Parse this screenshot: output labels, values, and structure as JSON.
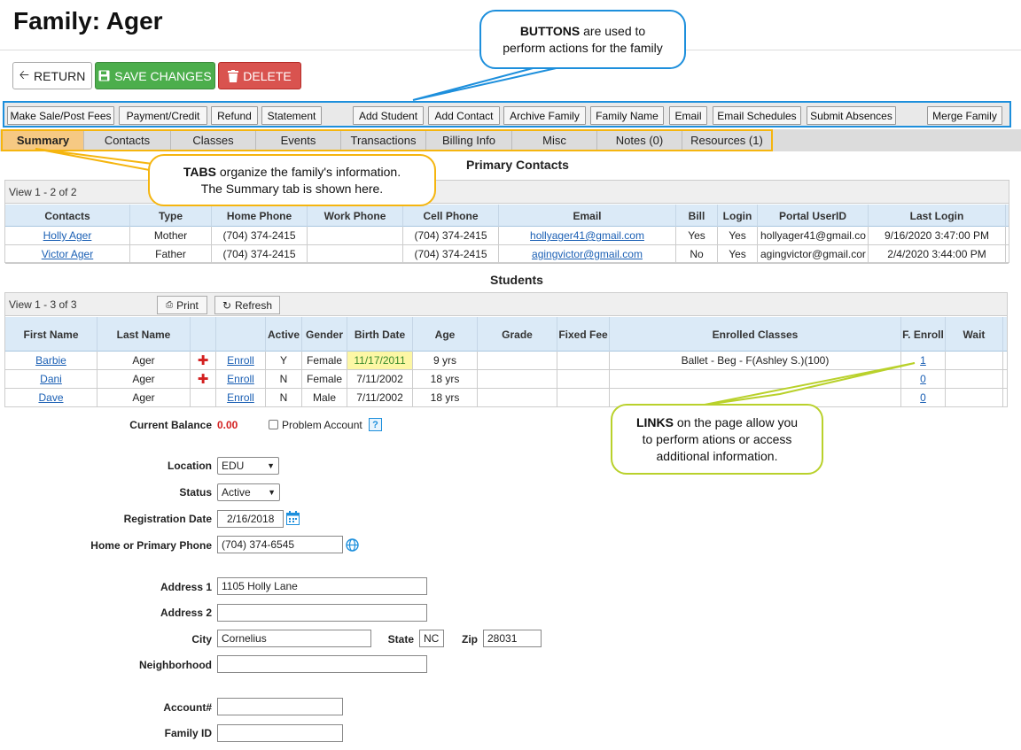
{
  "page": {
    "title": "Family: Ager"
  },
  "actions": {
    "return_label": "RETURN",
    "save_label": "SAVE CHANGES",
    "delete_label": "DELETE"
  },
  "toolbar": {
    "make_sale": "Make Sale/Post Fees",
    "payment_credit": "Payment/Credit",
    "refund": "Refund",
    "statement": "Statement",
    "add_student": "Add Student",
    "add_contact": "Add Contact",
    "archive_family": "Archive Family",
    "family_name": "Family Name",
    "email": "Email",
    "email_schedules": "Email Schedules",
    "submit_absences": "Submit Absences",
    "merge_family": "Merge Family"
  },
  "tabs": [
    "Summary",
    "Contacts",
    "Classes",
    "Events",
    "Transactions",
    "Billing Info",
    "Misc",
    "Notes (0)",
    "Resources (1)"
  ],
  "callouts": {
    "buttons_bold": "BUTTONS",
    "buttons_line1": " are used to",
    "buttons_line2": "perform actions for the family",
    "tabs_bold": "TABS",
    "tabs_line1": " organize the family's information.",
    "tabs_line2": "The Summary tab is shown here.",
    "links_bold": "LINKS",
    "links_line1": " on the page allow you",
    "links_line2": "to perform ations or access",
    "links_line3": "additional information."
  },
  "contacts": {
    "section_title": "Primary Contacts",
    "caption": "View 1 - 2 of 2",
    "headers": [
      "Contacts",
      "Type",
      "Home Phone",
      "Work Phone",
      "Cell Phone",
      "Email",
      "Bill",
      "Login",
      "Portal UserID",
      "Last Login"
    ],
    "rows": [
      {
        "name": "Holly Ager",
        "type": "Mother",
        "home": "(704) 374-2415",
        "work": "",
        "cell": "(704) 374-2415",
        "email": "hollyager41@gmail.com",
        "bill": "Yes",
        "login": "Yes",
        "portal": "hollyager41@gmail.co",
        "last": "9/16/2020 3:47:00 PM"
      },
      {
        "name": "Victor Ager",
        "type": "Father",
        "home": "(704) 374-2415",
        "work": "",
        "cell": "(704) 374-2415",
        "email": "agingvictor@gmail.com",
        "bill": "No",
        "login": "Yes",
        "portal": "agingvictor@gmail.cor",
        "last": "2/4/2020 3:44:00 PM"
      }
    ]
  },
  "students": {
    "section_title": "Students",
    "caption": "View 1 - 3 of 3",
    "print_label": "Print",
    "refresh_label": "Refresh",
    "headers": {
      "first": "First Name",
      "last": "Last Name",
      "active": "Active",
      "gender": "Gender",
      "birth": "Birth Date",
      "age": "Age",
      "grade": "Grade",
      "fixed_fee": "Fixed Fee",
      "enrolled": "Enrolled Classes",
      "f_enroll": "F. Enroll",
      "wait": "Wait"
    },
    "rows": [
      {
        "first": "Barbie",
        "last": "Ager",
        "enroll": "Enroll",
        "active": "Y",
        "gender": "Female",
        "birth": "11/17/2011",
        "age": "9 yrs",
        "grade": "",
        "fixed_fee": "",
        "classes": "Ballet - Beg - F(Ashley S.)(100)",
        "f_enroll": "1",
        "wait": ""
      },
      {
        "first": "Dani",
        "last": "Ager",
        "enroll": "Enroll",
        "active": "N",
        "gender": "Female",
        "birth": "7/11/2002",
        "age": "18 yrs",
        "grade": "",
        "fixed_fee": "",
        "classes": "",
        "f_enroll": "0",
        "wait": ""
      },
      {
        "first": "Dave",
        "last": "Ager",
        "enroll": "Enroll",
        "active": "N",
        "gender": "Male",
        "birth": "7/11/2002",
        "age": "18 yrs",
        "grade": "",
        "fixed_fee": "",
        "classes": "",
        "f_enroll": "0",
        "wait": ""
      }
    ]
  },
  "form": {
    "current_balance_label": "Current Balance",
    "current_balance": "0.00",
    "problem_account_label": "Problem Account",
    "location_label": "Location",
    "location": "EDU",
    "status_label": "Status",
    "status": "Active",
    "registration_date_label": "Registration Date",
    "registration_date": "2/16/2018",
    "phone_label": "Home or Primary Phone",
    "phone": "(704) 374-6545",
    "address1_label": "Address 1",
    "address1": "1105 Holly Lane",
    "address2_label": "Address 2",
    "address2": "",
    "city_label": "City",
    "city": "Cornelius",
    "state_label": "State",
    "state": "NC",
    "zip_label": "Zip",
    "zip": "28031",
    "neighborhood_label": "Neighborhood",
    "neighborhood": "",
    "account_label": "Account#",
    "account": "",
    "family_id_label": "Family ID",
    "family_id": ""
  },
  "colors": {
    "accent_blue": "#1d8fdc",
    "tab_highlight": "#f5b50f",
    "links_callout": "#b9d12b",
    "save_green": "#4cae4c",
    "delete_red": "#d9534f",
    "balance_red": "#d32020"
  }
}
